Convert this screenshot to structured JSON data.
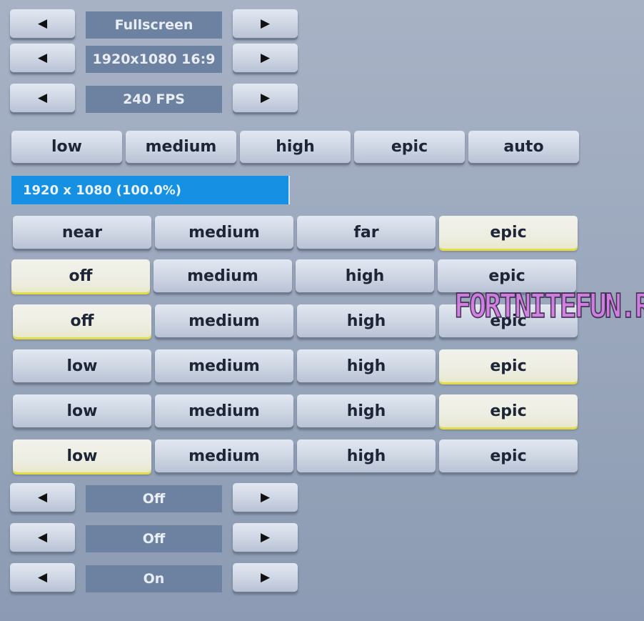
{
  "arrow_rows_top": [
    {
      "value": "Fullscreen"
    },
    {
      "value": "1920x1080 16:9"
    },
    {
      "value": "240 FPS"
    }
  ],
  "arrows": {
    "left": "◀",
    "right": "▶",
    "left_icon": "triangle-left-icon",
    "right_icon": "triangle-right-icon"
  },
  "quality_presets": {
    "options": [
      "low",
      "medium",
      "high",
      "epic",
      "auto"
    ],
    "selected": null
  },
  "resolution_bar": {
    "label": "1920 x 1080 (100.0%)",
    "fill_percent": 100,
    "color": "#1590e2"
  },
  "option_rows": [
    {
      "options": [
        "near",
        "medium",
        "far",
        "epic"
      ],
      "selected": 3
    },
    {
      "options": [
        "off",
        "medium",
        "high",
        "epic"
      ],
      "selected": 0
    },
    {
      "options": [
        "off",
        "medium",
        "high",
        "epic"
      ],
      "selected": 0
    },
    {
      "options": [
        "low",
        "medium",
        "high",
        "epic"
      ],
      "selected": 3
    },
    {
      "options": [
        "low",
        "medium",
        "high",
        "epic"
      ],
      "selected": 3
    },
    {
      "options": [
        "low",
        "medium",
        "high",
        "epic"
      ],
      "selected": 0
    }
  ],
  "arrow_rows_bottom": [
    {
      "value": "Off"
    },
    {
      "value": "Off"
    },
    {
      "value": "On"
    }
  ],
  "watermark": "FORTNITEFUN.RU",
  "colors": {
    "selected_accent": "#e3dc47",
    "value_box": "#6d81a0"
  }
}
